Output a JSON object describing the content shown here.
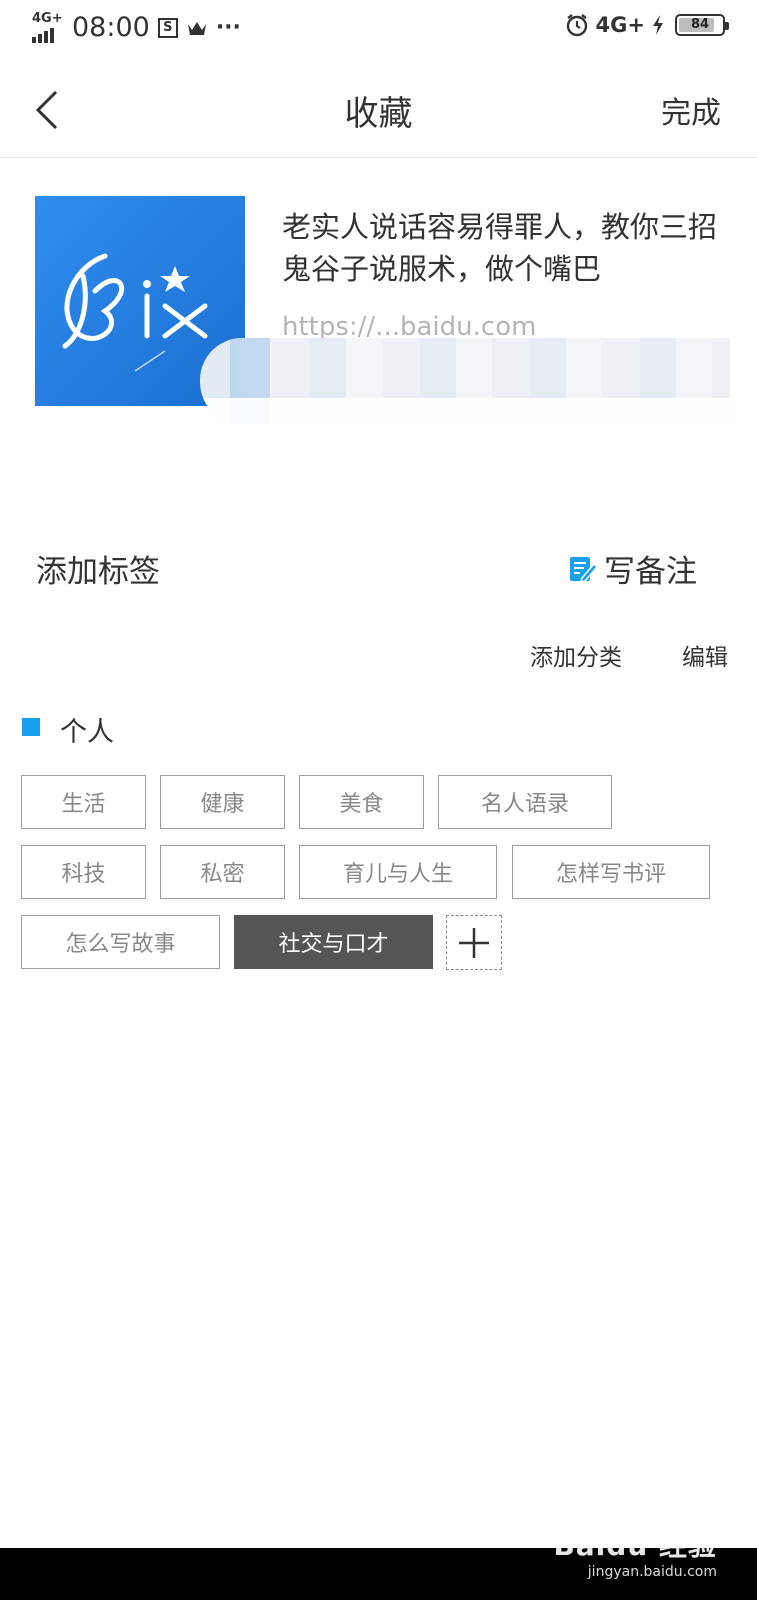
{
  "status_bar": {
    "network_left": "4G+",
    "time": "08:00",
    "s_icon_text": "S",
    "more": "···",
    "network_right": "4G+",
    "battery_level": "84",
    "battery_fraction": 0.84
  },
  "nav": {
    "title": "收藏",
    "done_label": "完成"
  },
  "card": {
    "title": "老实人说话容易得罪人，教你三招鬼谷子说服术，做个嘴巴",
    "url": "https://...baidu.com"
  },
  "add_tag_label": "添加标签",
  "write_note_label": "写备注",
  "add_category_label": "添加分类",
  "edit_label": "编辑",
  "section": {
    "label": "个人"
  },
  "tags": [
    {
      "label": "生活",
      "selected": false
    },
    {
      "label": "健康",
      "selected": false
    },
    {
      "label": "美食",
      "selected": false
    },
    {
      "label": "名人语录",
      "selected": false
    },
    {
      "label": "科技",
      "selected": false
    },
    {
      "label": "私密",
      "selected": false
    },
    {
      "label": "育儿与人生",
      "selected": false
    },
    {
      "label": "怎样写书评",
      "selected": false
    },
    {
      "label": "怎么写故事",
      "selected": false
    },
    {
      "label": "社交与口才",
      "selected": true
    }
  ],
  "watermark": {
    "brand": "Baidu 经验",
    "domain": "jingyan.baidu.com"
  },
  "colors": {
    "accent": "#1aa1ee",
    "selected_tag": "#555555",
    "thumb_blue": "#2280e6"
  },
  "icons": {
    "back": "chevron-left-icon",
    "note": "edit-note-icon",
    "add": "plus-icon",
    "alarm": "alarm-clock-icon",
    "charging": "lightning-icon",
    "crown": "crown-icon"
  }
}
